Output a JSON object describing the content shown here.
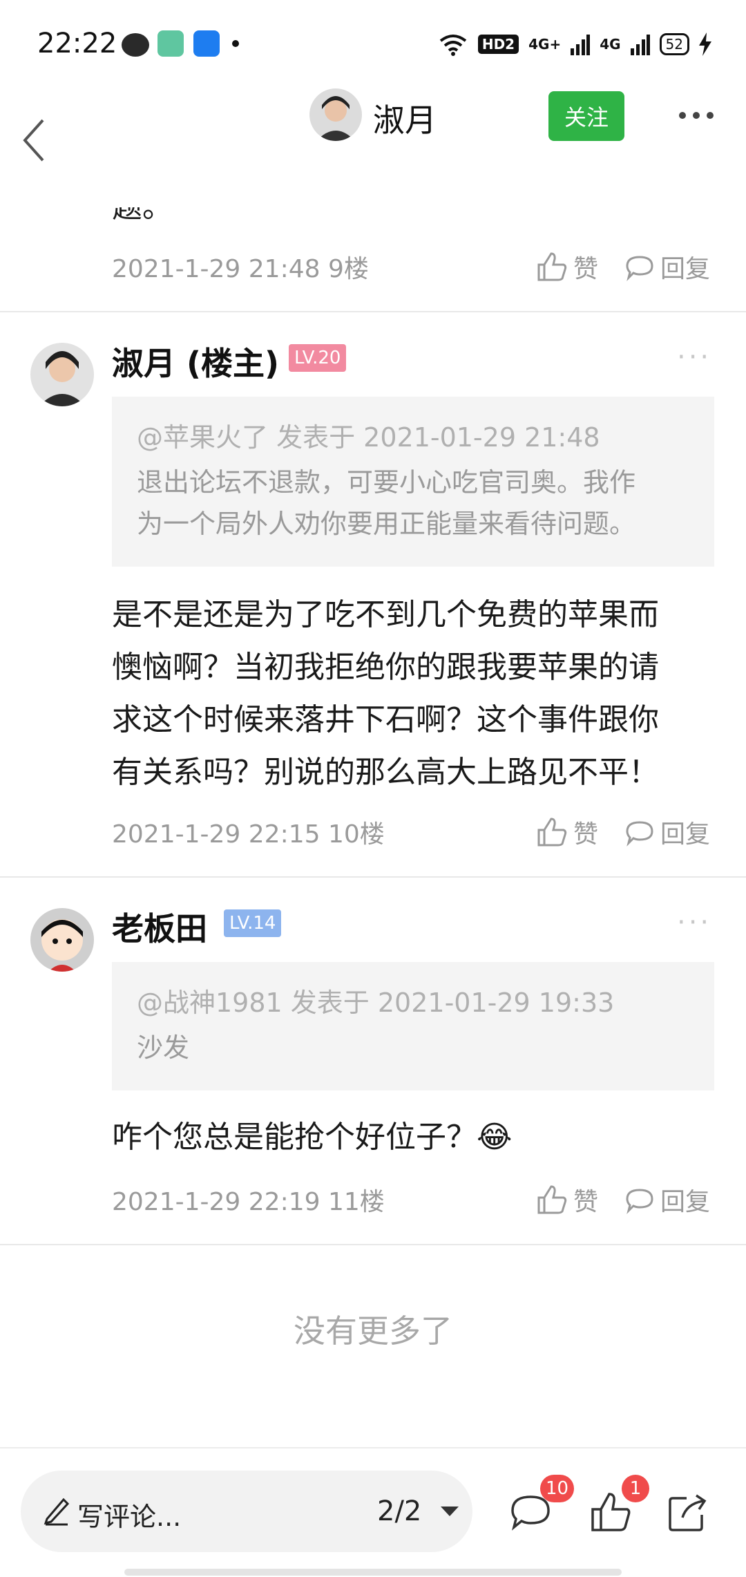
{
  "status_bar": {
    "time": "22:22",
    "network_hd": "HD2",
    "signal1": "4G+",
    "signal2": "4G",
    "battery": "52"
  },
  "header": {
    "user_name": "淑月",
    "follow_label": "关注"
  },
  "partial_post": {
    "text_tail": "题。",
    "meta": "2021-1-29 21:48  9楼",
    "like_label": "赞",
    "reply_label": "回复"
  },
  "posts": [
    {
      "name": "淑月 (楼主)",
      "level": "LV.20",
      "level_color": "#f28aa0",
      "quote_meta": "@苹果火了 发表于 2021-01-29 21:48",
      "quote_text_1": "退出论坛不退款，可要小心吃官司奥。我作",
      "quote_text_2": "为一个局外人劝你要用正能量来看待问题。",
      "body_1": "是不是还是为了吃不到几个免费的苹果而",
      "body_2": "懊恼啊？当初我拒绝你的跟我要苹果的请",
      "body_3": "求这个时候来落井下石啊？这个事件跟你",
      "body_4": "有关系吗？别说的那么高大上路见不平！",
      "meta": "2021-1-29 22:15  10楼",
      "like_label": "赞",
      "reply_label": "回复"
    },
    {
      "name": "老板田",
      "level": "LV.14",
      "level_color": "#8db4ee",
      "quote_meta": "@战神1981 发表于 2021-01-29 19:33",
      "quote_text_1": "沙发",
      "body_1": "咋个您总是能抢个好位子？😂",
      "meta": "2021-1-29 22:19  11楼",
      "like_label": "赞",
      "reply_label": "回复"
    }
  ],
  "no_more_text": "没有更多了",
  "bottom_bar": {
    "comment_placeholder": "写评论...",
    "page_indicator": "2/2",
    "comment_count": "10",
    "like_count": "1"
  },
  "colors": {
    "follow_green": "#2fb346",
    "badge_red": "#f04b4b"
  }
}
